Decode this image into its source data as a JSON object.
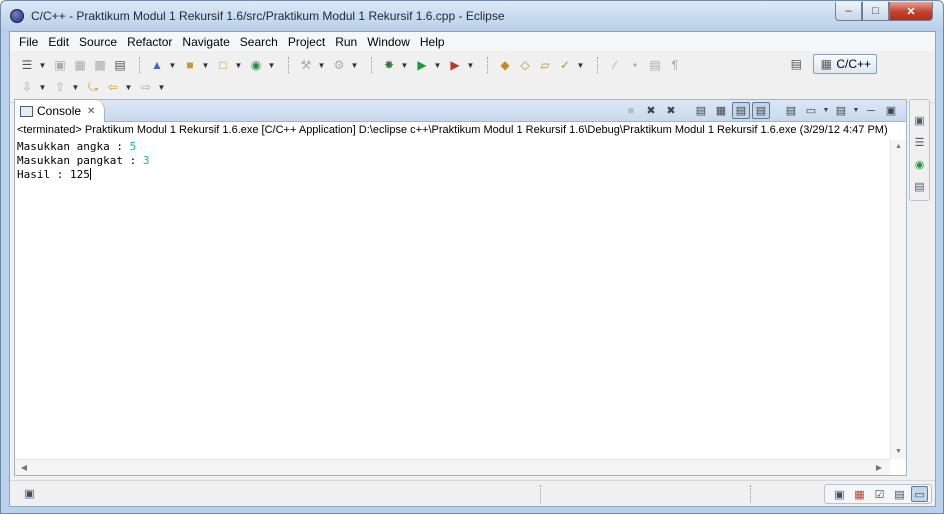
{
  "window": {
    "title": "C/C++ - Praktikum Modul 1 Rekursif 1.6/src/Praktikum Modul 1 Rekursif 1.6.cpp - Eclipse",
    "controls": {
      "minimize": "–",
      "maximize": "□",
      "close": "✕"
    }
  },
  "menu": [
    "File",
    "Edit",
    "Source",
    "Refactor",
    "Navigate",
    "Search",
    "Project",
    "Run",
    "Window",
    "Help"
  ],
  "perspective": {
    "label": "C/C++"
  },
  "console": {
    "tab_label": "Console",
    "tab_close": "✕",
    "description": "<terminated> Praktikum Modul 1 Rekursif 1.6.exe [C/C++ Application] D:\\eclipse c++\\Praktikum Modul 1 Rekursif 1.6\\Debug\\Praktikum Modul 1 Rekursif 1.6.exe (3/29/12 4:47 PM)",
    "lines": [
      {
        "prompt": "Masukkan angka : ",
        "input": "5"
      },
      {
        "prompt": "Masukkan pangkat : ",
        "input": "3"
      },
      {
        "prompt": "Hasil : 125",
        "input": ""
      }
    ],
    "input_color": "#00c87f"
  },
  "icons": {
    "toolbar_row1": [
      "new-icon",
      "save-icon",
      "save-all-icon",
      "print-icon",
      "build-binary-icon",
      "new-cpp-project-icon",
      "new-source-folder-icon",
      "new-class-icon",
      "search-icon",
      "build-icon",
      "build-config-icon",
      "debug-icon",
      "run-icon",
      "external-tools-icon",
      "open-type-icon",
      "open-element-icon",
      "open-resource-icon",
      "toggle-mark-occurrences-icon",
      "pin-icon",
      "show-whitespace-icon",
      "show-block-icon"
    ],
    "toolbar_row2": [
      "next-annotation-icon",
      "prev-annotation-icon",
      "last-edit-icon",
      "back-icon",
      "forward-icon"
    ],
    "console_tools": [
      "terminate-icon",
      "remove-launch-icon",
      "remove-all-icon",
      "clear-console-icon",
      "scroll-lock-icon",
      "show-on-stdout-icon",
      "show-on-stderr-icon",
      "pin-console-icon",
      "display-console-icon",
      "open-console-icon",
      "minimize-icon",
      "maximize-icon"
    ],
    "right_trim": [
      "restore-icon",
      "outline-icon",
      "make-targets-icon",
      "task-list-icon"
    ],
    "status_right": [
      "restore-icon",
      "problems-icon",
      "tasks-icon",
      "properties-icon",
      "console-icon"
    ]
  }
}
